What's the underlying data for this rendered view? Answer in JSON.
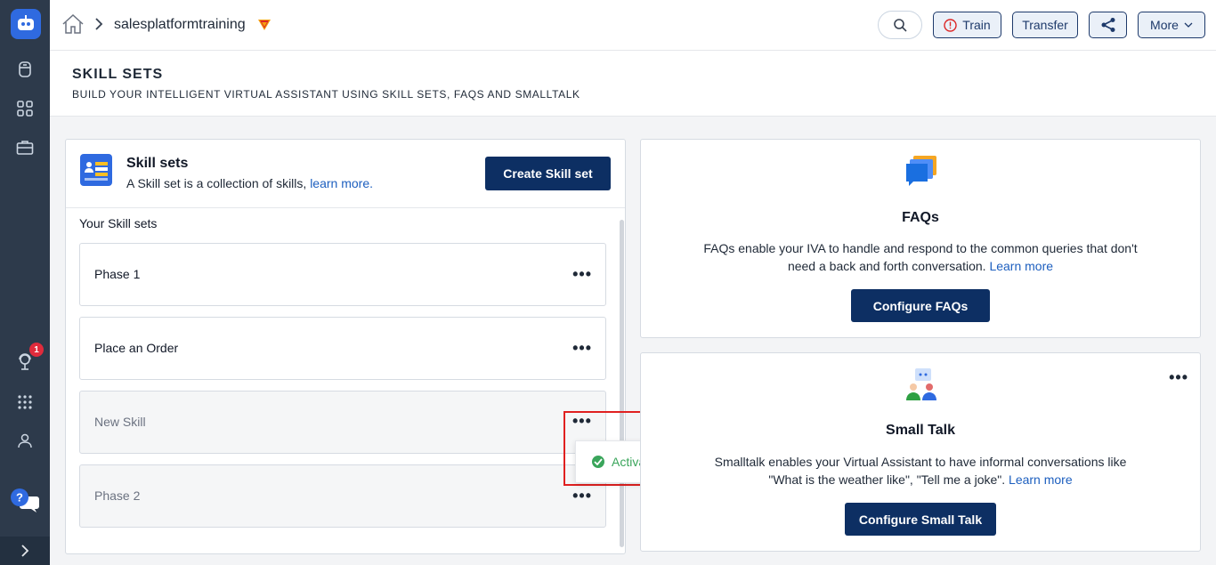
{
  "header": {
    "app_name": "salesplatformtraining",
    "buttons": {
      "train": "Train",
      "transfer": "Transfer",
      "more": "More"
    }
  },
  "page": {
    "title": "SKILL SETS",
    "subtitle": "BUILD YOUR INTELLIGENT VIRTUAL ASSISTANT USING SKILL SETS, FAQS AND SMALLTALK"
  },
  "rail": {
    "notification_count": "1"
  },
  "skill_sets": {
    "title": "Skill sets",
    "description": "A Skill set is a collection of skills,",
    "learn_more": "learn more.",
    "create_label": "Create Skill set",
    "list_heading": "Your Skill sets",
    "items": [
      {
        "name": "Phase 1",
        "active": true
      },
      {
        "name": "Place an Order",
        "active": true
      },
      {
        "name": "New Skill",
        "active": false
      },
      {
        "name": "Phase 2",
        "active": false
      }
    ],
    "menu": {
      "activate_label": "Activate"
    }
  },
  "faqs": {
    "title": "FAQs",
    "description_line1": "FAQs enable your IVA to handle and respond to the common queries that don't",
    "description_line2": "need a back and forth conversation.",
    "learn_more": "Learn more",
    "button": "Configure FAQs"
  },
  "small_talk": {
    "title": "Small Talk",
    "description_line1": "Smalltalk enables your Virtual Assistant to have informal conversations like",
    "description_line2": "\"What is the weather like\", \"Tell me a joke\".",
    "learn_more": "Learn more",
    "button": "Configure Small Talk"
  },
  "colors": {
    "primary": "#0d2f63",
    "rail": "#2d3a4b",
    "link": "#1d5fbf",
    "success": "#3aa55b",
    "highlight": "#e02020"
  }
}
